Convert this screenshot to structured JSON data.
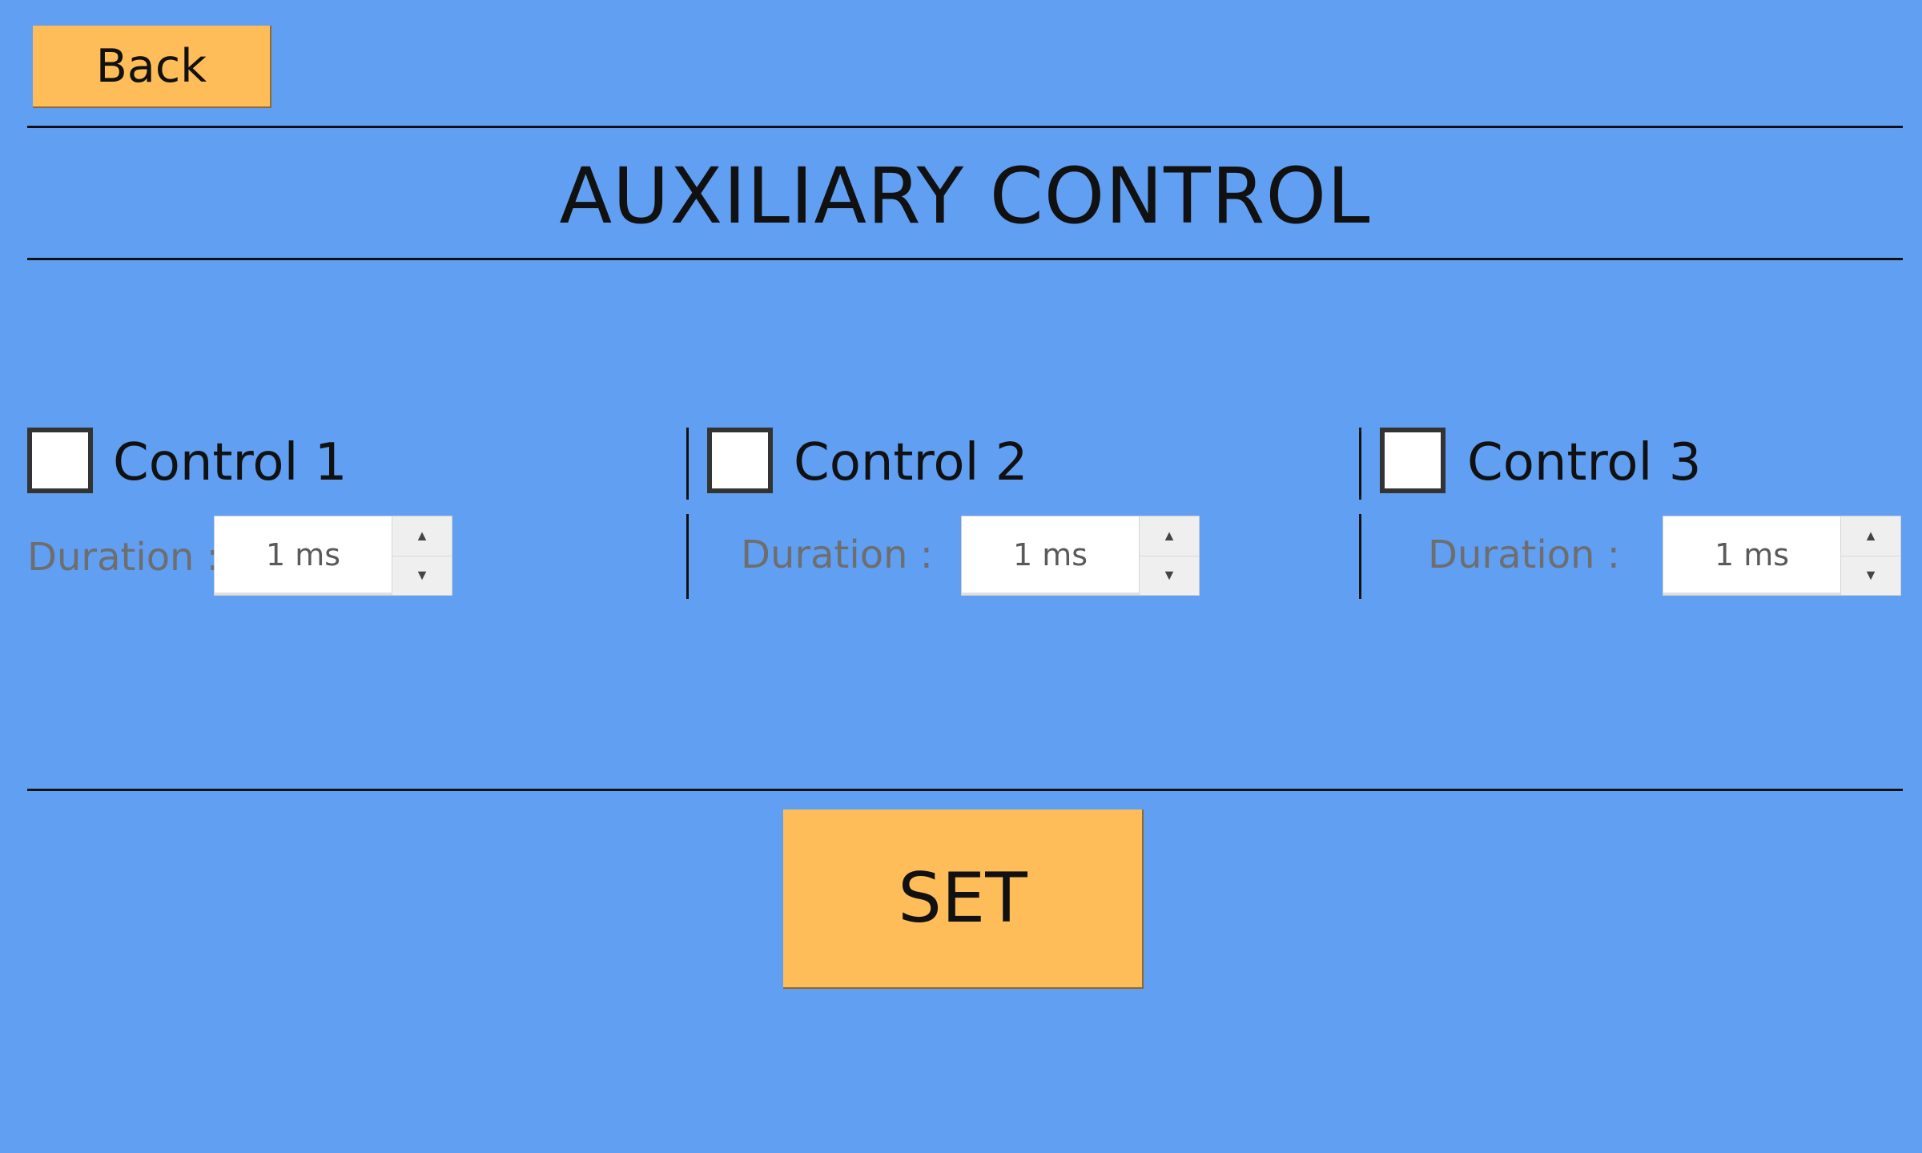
{
  "header": {
    "back_label": "Back",
    "title": "AUXILIARY CONTROL"
  },
  "controls": [
    {
      "label": "Control 1",
      "checked": false,
      "duration_label": "Duration :",
      "duration_value": "1 ms"
    },
    {
      "label": "Control 2",
      "checked": false,
      "duration_label": "Duration :",
      "duration_value": "1 ms"
    },
    {
      "label": "Control 3",
      "checked": false,
      "duration_label": "Duration :",
      "duration_value": "1 ms"
    }
  ],
  "footer": {
    "set_label": "SET"
  },
  "icons": {
    "spin_up": "▲",
    "spin_down": "▼"
  },
  "colors": {
    "background": "#619FF2",
    "button": "#FFBD59"
  }
}
